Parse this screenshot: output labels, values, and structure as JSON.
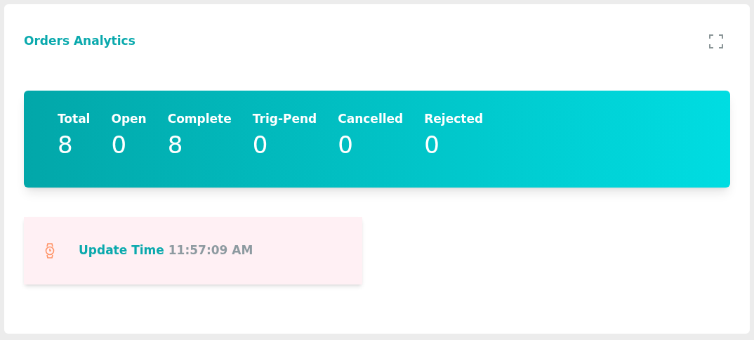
{
  "title": "Orders Analytics",
  "stats": [
    {
      "label": "Total",
      "value": "8"
    },
    {
      "label": "Open",
      "value": "0"
    },
    {
      "label": "Complete",
      "value": "8"
    },
    {
      "label": "Trig-Pend",
      "value": "0"
    },
    {
      "label": "Cancelled",
      "value": "0"
    },
    {
      "label": "Rejected",
      "value": "0"
    }
  ],
  "update": {
    "label": "Update Time",
    "time": "11:57:09 AM"
  }
}
